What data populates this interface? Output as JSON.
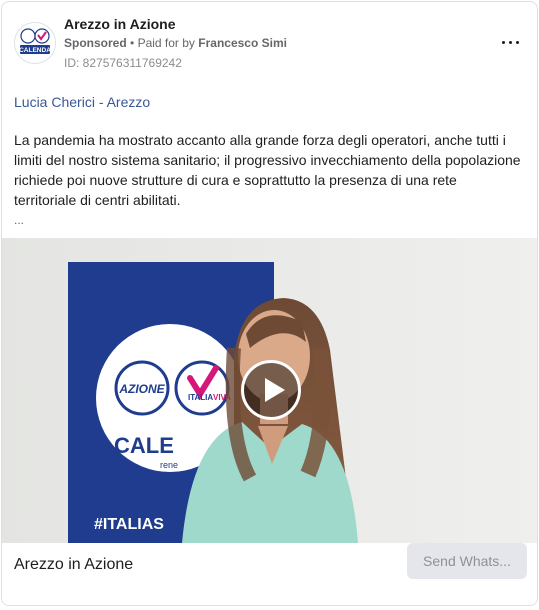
{
  "page": {
    "name": "Arezzo in Azione",
    "sponsored_label": "Sponsored",
    "paid_for_prefix": "Paid for by",
    "paid_for_by": "Francesco Simi",
    "ad_id": "ID: 827576311769242",
    "avatar_text": "CALENDA"
  },
  "post": {
    "headline": "Lucia Cherici - Arezzo",
    "body": "La pandemia ha mostrato accanto alla grande forza degli operatori, anche tutti i limiti del nostro sistema sanitario; il progressivo invecchiamento della popolazione richiede poi nuove strutture di cura e soprattutto la presenza di una rete territoriale di centri abilitati.",
    "ellipsis": "..."
  },
  "video": {
    "banner_azione": "AZIONE",
    "banner_italia": "ITALIA",
    "banner_viva": "VIVA",
    "banner_calenda": "CALE",
    "banner_rene": "rene",
    "banner_euro": "euro",
    "banner_hashtag": "#ITALIAS"
  },
  "footer": {
    "title": "Arezzo in Azione",
    "cta_label": "Send Whats..."
  },
  "colors": {
    "brand_blue": "#1f3c8f",
    "link_blue": "#385898",
    "cta_bg": "#e4e6eb"
  }
}
